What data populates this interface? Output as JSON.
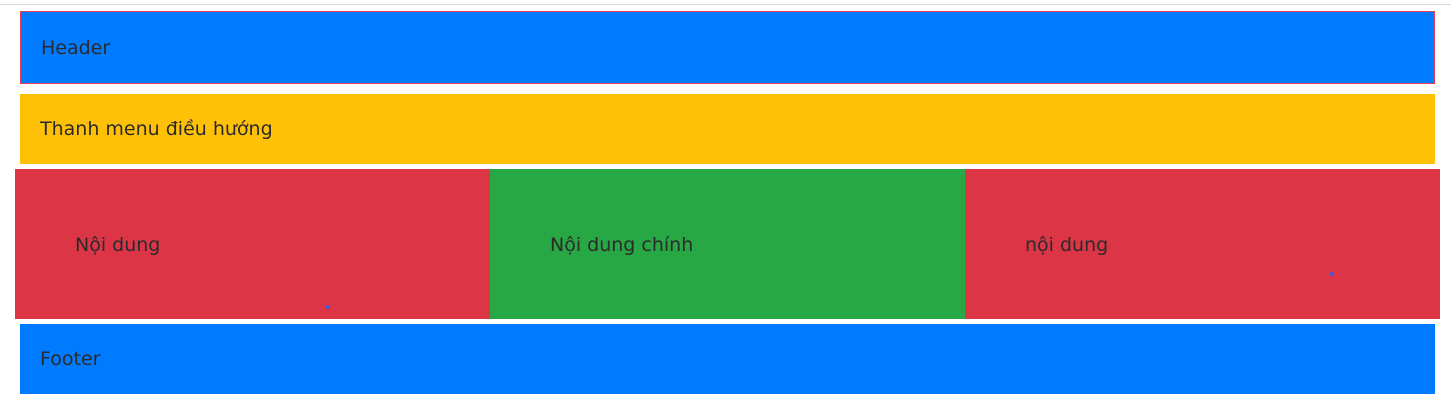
{
  "header": {
    "label": "Header"
  },
  "nav": {
    "label": "Thanh menu điều hướng"
  },
  "content": {
    "left": "Nội dung",
    "main": "Nội dung chính",
    "right": "nội dung"
  },
  "footer": {
    "label": "Footer"
  },
  "colors": {
    "header": "#007bff",
    "nav": "#ffc107",
    "side_columns": "#dc3545",
    "main_column": "#28a745",
    "footer": "#007bff"
  }
}
